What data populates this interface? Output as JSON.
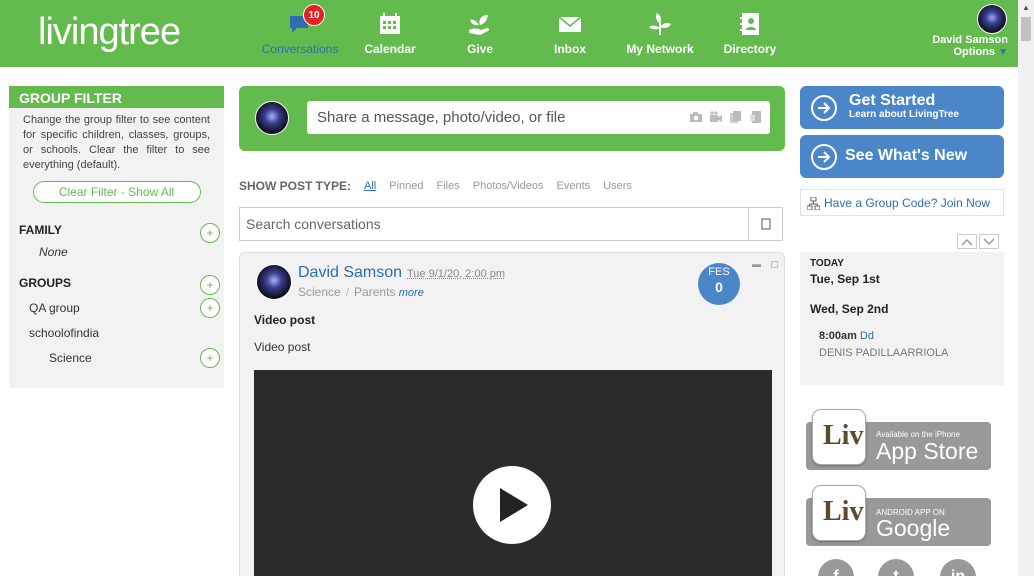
{
  "header": {
    "logo": "livingtree",
    "nav": [
      {
        "label": "Conversations",
        "icon": "chat-icon",
        "badge": "10",
        "active": true
      },
      {
        "label": "Calendar",
        "icon": "calendar-icon"
      },
      {
        "label": "Give",
        "icon": "give-icon"
      },
      {
        "label": "Inbox",
        "icon": "inbox-icon"
      },
      {
        "label": "My Network",
        "icon": "network-icon"
      },
      {
        "label": "Directory",
        "icon": "directory-icon"
      }
    ],
    "user": {
      "name": "David Samson",
      "options": "Options"
    }
  },
  "sidebar": {
    "title": "GROUP FILTER",
    "description": "Change the group filter to see content for specific children, classes, groups, or schools. Clear the filter to see everything (default).",
    "clear_button": "Clear Filter - Show All",
    "family_title": "FAMILY",
    "family_none": "None",
    "groups_title": "GROUPS",
    "groups": [
      "QA group",
      "schoolofindia",
      "Science"
    ]
  },
  "composer": {
    "placeholder": "Share a message, photo/video, or file"
  },
  "post_types": {
    "label": "SHOW POST TYPE:",
    "items": [
      "All",
      "Pinned",
      "Files",
      "Photos/Videos",
      "Events",
      "Users"
    ],
    "active": "All"
  },
  "search": {
    "placeholder": "Search conversations"
  },
  "post": {
    "author": "David Samson",
    "date": "Tue 9/1/20, 2:00 pm",
    "meta1": "Science",
    "meta2": "Parents",
    "more": "more",
    "badge_label": "FES",
    "badge_count": "0",
    "title": "Video post",
    "body": "Video post"
  },
  "right": {
    "get_started": {
      "title": "Get Started",
      "subtitle": "Learn about LivingTree"
    },
    "whats_new": {
      "title": "See What's New"
    },
    "group_code": "Have a Group Code? Join Now",
    "calendar": {
      "today": "TODAY",
      "day1": "Tue, Sep 1st",
      "day2": "Wed, Sep 2nd",
      "time": "8:00am",
      "event": "Dd",
      "who": "DENIS PADILLAARRIOLA"
    },
    "app_store": {
      "small": "Available on the iPhone",
      "big": "App Store"
    },
    "google_play": {
      "small": "ANDROID APP ON",
      "big": "Google play"
    },
    "store_icon_text": "Liv",
    "social": [
      "f",
      "t",
      "in"
    ]
  },
  "colors": {
    "brand_green": "#63bb4e",
    "link_blue": "#2e6db0",
    "cta_blue": "#4a86c8",
    "badge_red": "#e32323"
  }
}
